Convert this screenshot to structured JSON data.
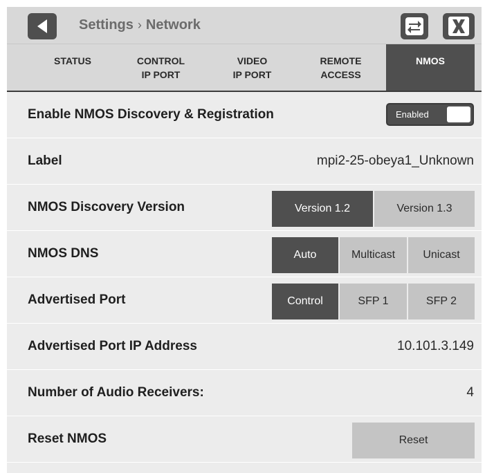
{
  "header": {
    "breadcrumb_parent": "Settings",
    "breadcrumb_sep": "›",
    "breadcrumb_current": "Network",
    "icons": {
      "back": "back-arrow-icon",
      "swap": "swap-arrows-icon",
      "close": "close-x-icon"
    }
  },
  "tabs": [
    {
      "line1": "STATUS",
      "line2": "",
      "active": false
    },
    {
      "line1": "CONTROL",
      "line2": "IP PORT",
      "active": false
    },
    {
      "line1": "VIDEO",
      "line2": "IP PORT",
      "active": false
    },
    {
      "line1": "REMOTE",
      "line2": "ACCESS",
      "active": false
    },
    {
      "line1": "NMOS",
      "line2": "",
      "active": true
    }
  ],
  "rows": {
    "enable": {
      "label": "Enable NMOS Discovery & Registration",
      "toggle_text": "Enabled",
      "toggle_on": true
    },
    "label": {
      "label": "Label",
      "value": "mpi2-25-obeya1_Unknown"
    },
    "discovery_version": {
      "label": "NMOS Discovery Version",
      "options": [
        "Version 1.2",
        "Version 1.3"
      ],
      "selected": "Version 1.2"
    },
    "dns": {
      "label": "NMOS DNS",
      "options": [
        "Auto",
        "Multicast",
        "Unicast"
      ],
      "selected": "Auto"
    },
    "advertised_port": {
      "label": "Advertised Port",
      "options": [
        "Control",
        "SFP 1",
        "SFP 2"
      ],
      "selected": "Control"
    },
    "advertised_ip": {
      "label": "Advertised Port IP Address",
      "value": "10.101.3.149"
    },
    "audio_receivers": {
      "label": "Number of Audio Receivers:",
      "value": "4"
    },
    "reset": {
      "label": "Reset NMOS",
      "button": "Reset"
    }
  },
  "colors": {
    "active": "#4f4f4f",
    "inactive": "#c4c4c4",
    "background": "#ececec",
    "header": "#d8d8d8"
  }
}
